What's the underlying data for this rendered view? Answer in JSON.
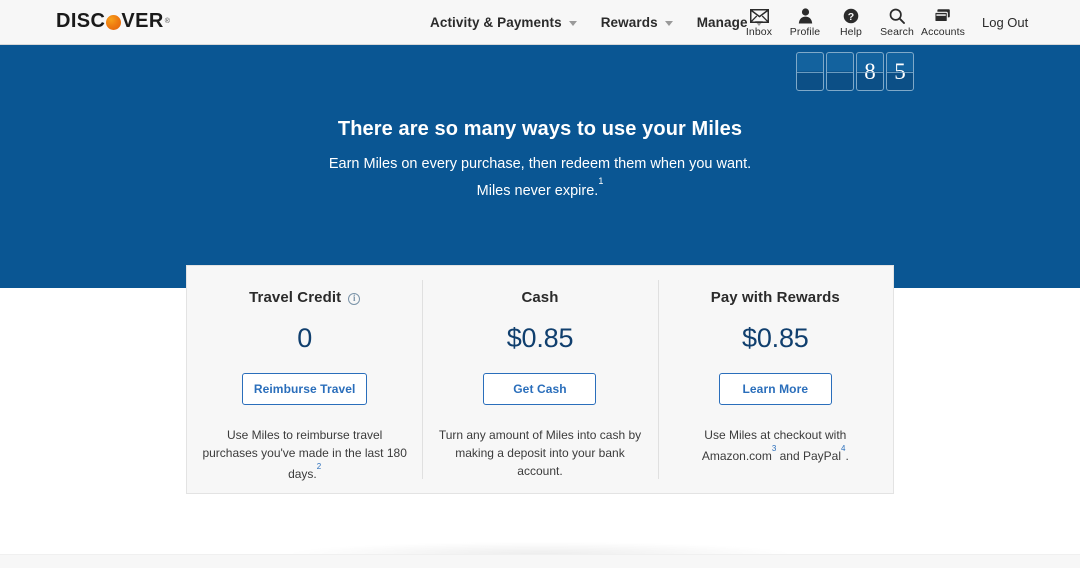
{
  "header": {
    "logo": {
      "pre": "DISC",
      "post": "VER",
      "tm": "®",
      "icon": "discover-logo"
    },
    "nav": [
      {
        "label": "Activity & Payments",
        "icon": "chevron-down-icon"
      },
      {
        "label": "Rewards",
        "icon": "chevron-down-icon"
      },
      {
        "label": "Manage",
        "icon": "chevron-down-icon"
      }
    ],
    "icons": [
      {
        "label": "Inbox",
        "icon": "envelope-icon"
      },
      {
        "label": "Profile",
        "icon": "person-icon"
      },
      {
        "label": "Help",
        "icon": "question-circle-icon"
      },
      {
        "label": "Search",
        "icon": "search-icon"
      },
      {
        "label": "Accounts",
        "icon": "cards-icon"
      }
    ],
    "logout": "Log Out"
  },
  "hero": {
    "background_color": "#0a5693",
    "counter": {
      "digits": [
        "",
        "",
        "8",
        "5"
      ]
    },
    "title": "There are so many ways to use your Miles",
    "subtitle_line1": "Earn Miles on every purchase, then redeem them when you want.",
    "subtitle_line2": "Miles never expire.",
    "subtitle_footnote": "1"
  },
  "card": {
    "columns": [
      {
        "title": "Travel Credit",
        "has_info_icon": true,
        "info_icon": "info-icon",
        "value": "0",
        "button": "Reimburse Travel",
        "desc_line1": "Use Miles to reimburse travel purchases",
        "desc_line2": "you've made in the last 180 days.",
        "desc_footnote": "2"
      },
      {
        "title": "Cash",
        "has_info_icon": false,
        "value": "$0.85",
        "button": "Get Cash",
        "desc_line1": "Turn any amount of Miles into cash by",
        "desc_line2": "making a deposit into your bank",
        "desc_line3": "account.",
        "desc_footnote": ""
      },
      {
        "title": "Pay with Rewards",
        "has_info_icon": false,
        "value": "$0.85",
        "button": "Learn More",
        "desc_line1": "Use Miles at checkout with",
        "desc_line2_a": "Amazon.com",
        "desc_footnote_a": "3",
        "desc_line2_b": " and PayPal",
        "desc_footnote_b": "4",
        "desc_line2_c": "."
      }
    ]
  },
  "colors": {
    "brand_blue": "#0a5693",
    "accent_orange": "#ef7d12",
    "link_blue": "#2a6ebb",
    "value_navy": "#103f6e"
  }
}
